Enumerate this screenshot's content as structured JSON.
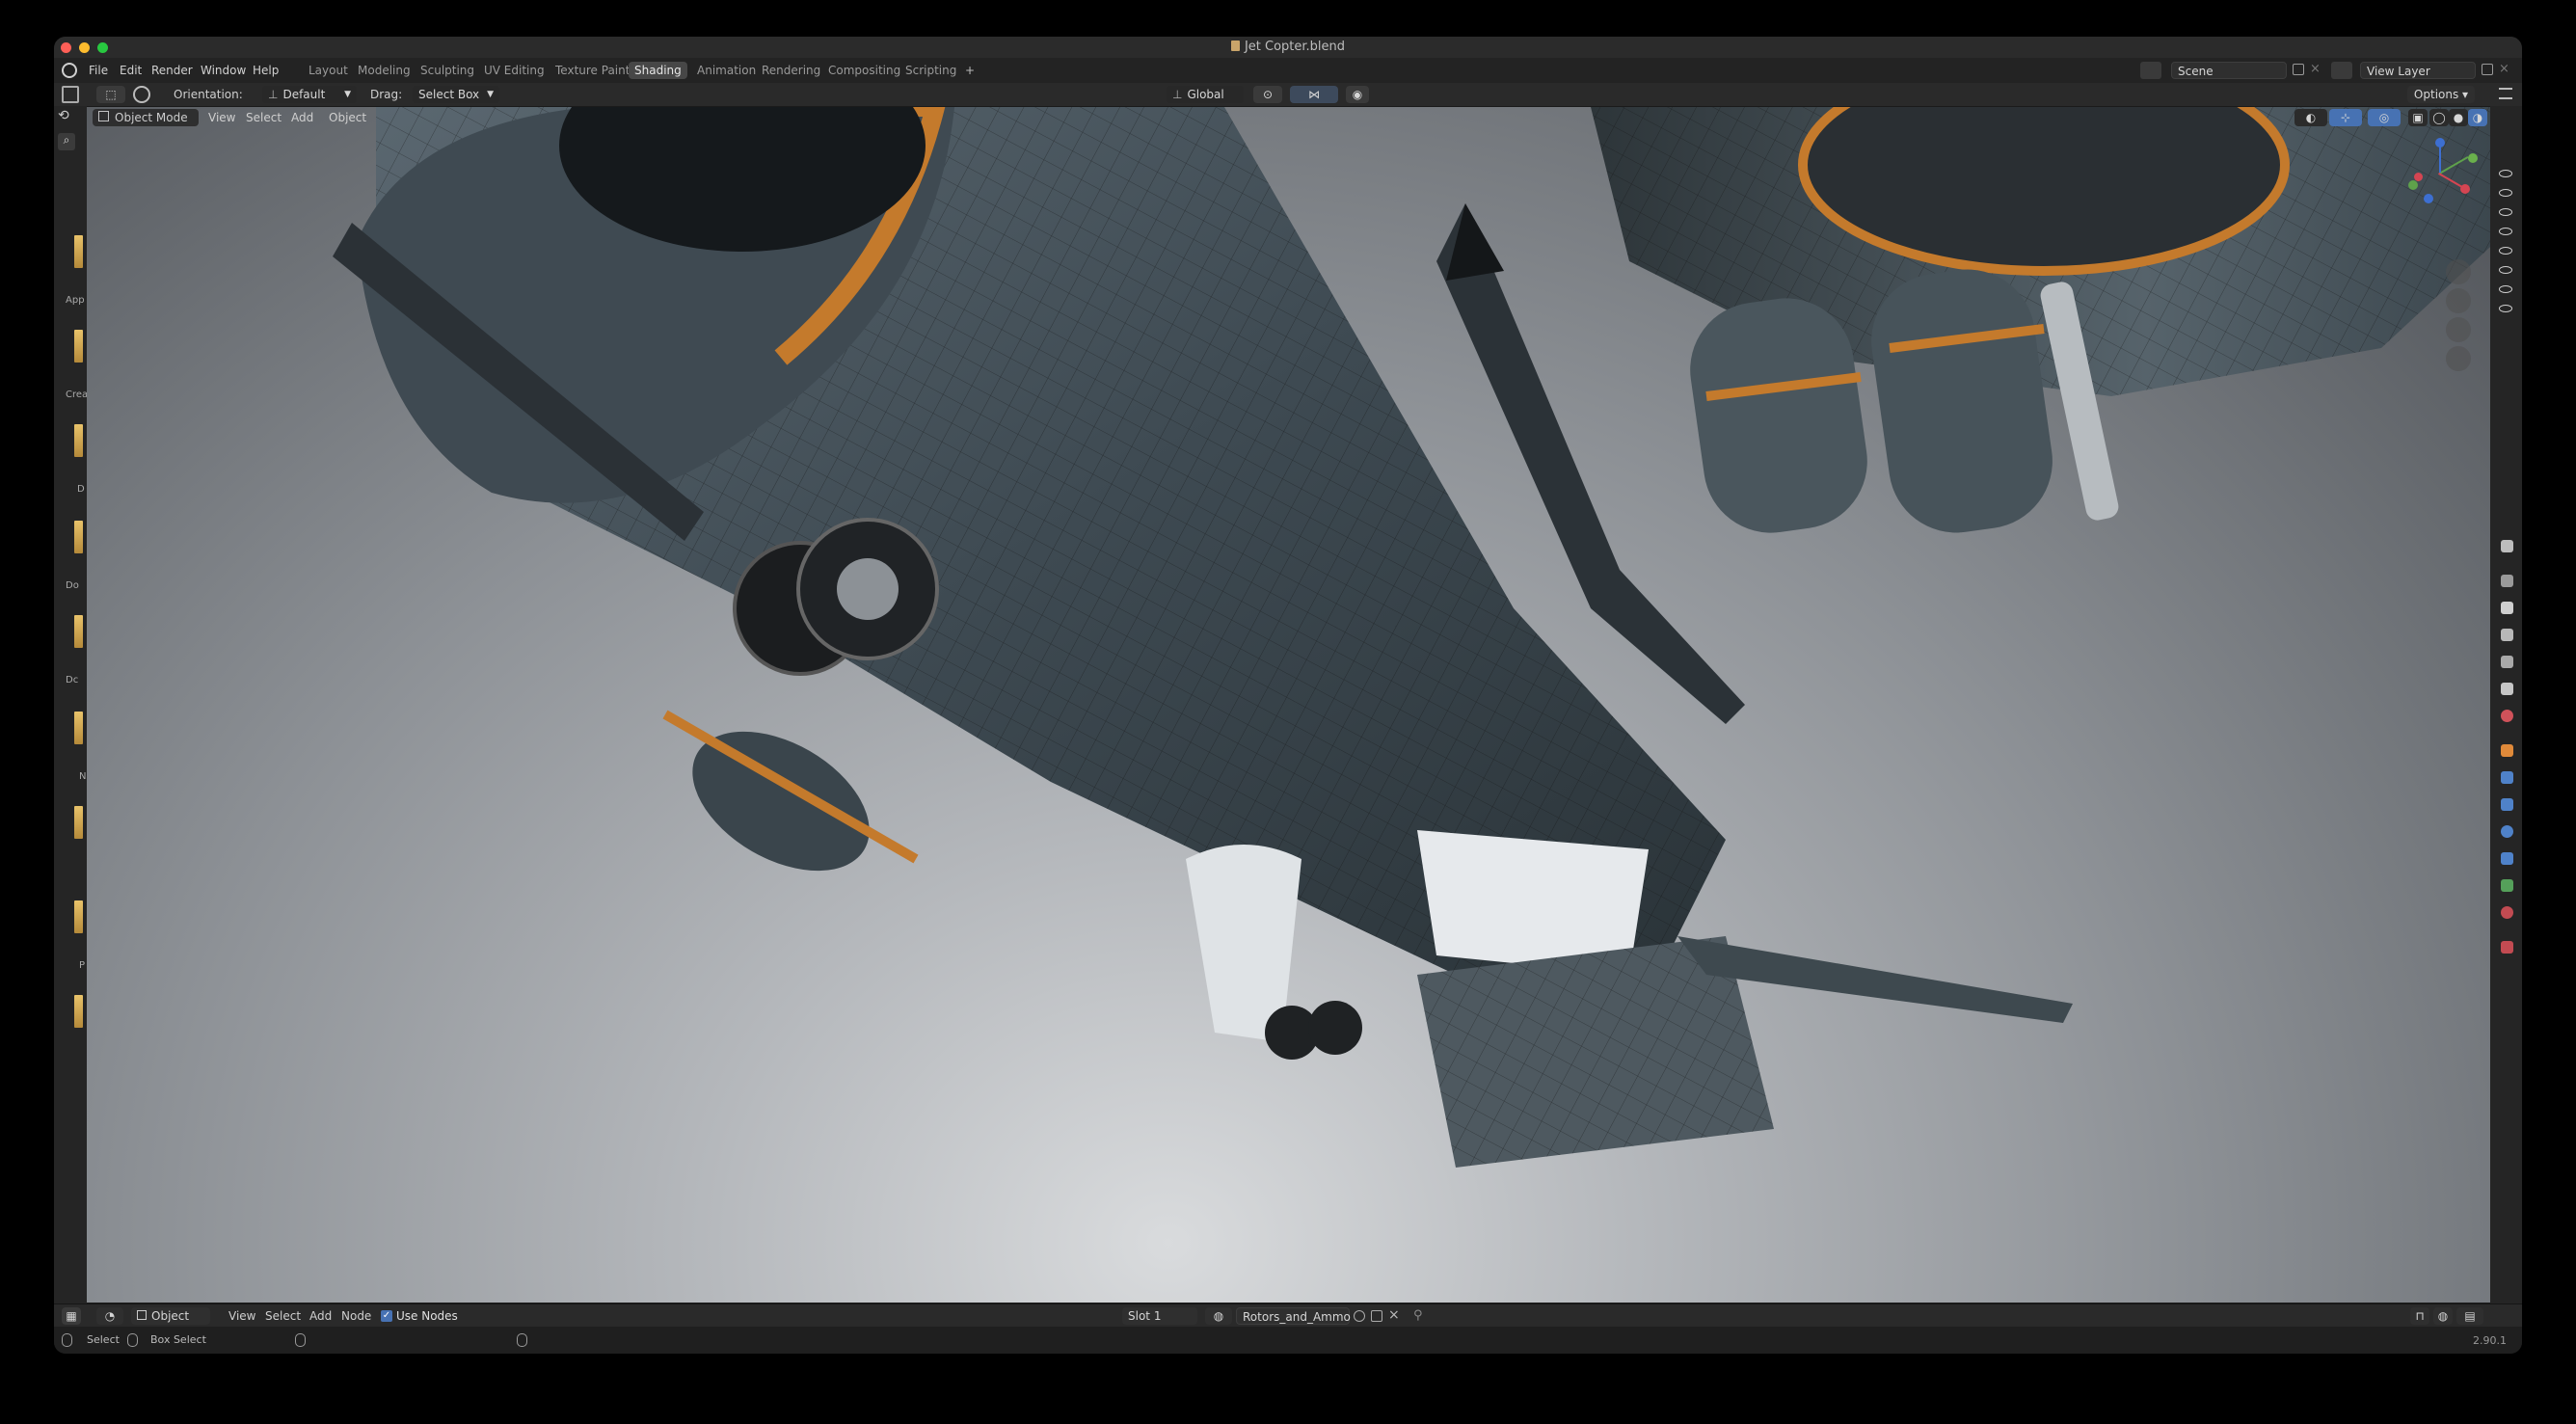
{
  "window": {
    "title": "Jet Copter.blend"
  },
  "menu": [
    "File",
    "Edit",
    "Render",
    "Window",
    "Help"
  ],
  "workspaces": [
    {
      "label": "Layout",
      "active": false
    },
    {
      "label": "Modeling",
      "active": false
    },
    {
      "label": "Sculpting",
      "active": false
    },
    {
      "label": "UV Editing",
      "active": false
    },
    {
      "label": "Texture Paint",
      "active": false
    },
    {
      "label": "Shading",
      "active": true
    },
    {
      "label": "Animation",
      "active": false
    },
    {
      "label": "Rendering",
      "active": false
    },
    {
      "label": "Compositing",
      "active": false
    },
    {
      "label": "Scripting",
      "active": false
    }
  ],
  "add_workspace": "+",
  "scene": {
    "name": "Scene"
  },
  "view_layer": {
    "name": "View Layer"
  },
  "toolbar": {
    "orientation_label": "Orientation:",
    "orientation_value": "Default",
    "drag_label": "Drag:",
    "drag_value": "Select Box",
    "transform_orientation": "Global",
    "options": "Options"
  },
  "viewport_header": {
    "mode": "Object Mode",
    "items": [
      "View",
      "Select",
      "Add",
      "Object"
    ]
  },
  "file_browser_labels": [
    "App",
    "Crea",
    "D",
    "Do",
    "Dc",
    "N",
    "P"
  ],
  "node_editor_header": {
    "type": "Object",
    "items": [
      "View",
      "Select",
      "Add",
      "Node"
    ],
    "use_nodes_label": "Use Nodes",
    "use_nodes_checked": true,
    "slot": "Slot 1",
    "material": "Rotors_and_Ammo"
  },
  "status_bar": {
    "select": "Select",
    "box_select": "Box Select",
    "version": "2.90.1"
  },
  "colors": {
    "accent_blue": "#4772b3",
    "traffic_red": "#fe5f57",
    "traffic_yellow": "#febc2e",
    "traffic_green": "#28c840",
    "orange_trim": "#c47a2c"
  }
}
